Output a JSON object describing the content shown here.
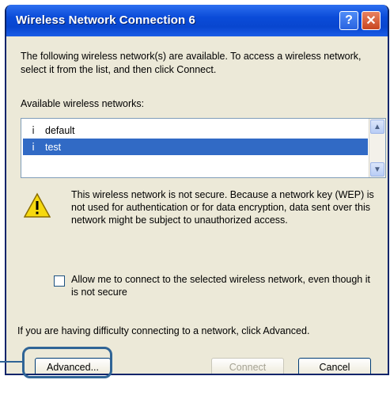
{
  "window": {
    "title": "Wireless Network Connection 6",
    "help_glyph": "?",
    "close_glyph": "✕"
  },
  "intro_text": "The following wireless network(s) are available. To access a wireless network, select it from the list, and then click Connect.",
  "networks_label": "Available wireless networks:",
  "networks": [
    {
      "name": "default",
      "selected": false
    },
    {
      "name": "test",
      "selected": true
    }
  ],
  "warning_text": "This wireless network is not secure. Because a network key (WEP) is not used for authentication or for data encryption, data sent over this network might be subject to unauthorized access.",
  "allow_checkbox": {
    "checked": false,
    "label": "Allow me to connect to the selected wireless network, even though it is not secure"
  },
  "help_text": "If you are having difficulty connecting to a network, click Advanced.",
  "buttons": {
    "advanced": "Advanced...",
    "connect": "Connect",
    "cancel": "Cancel"
  },
  "colors": {
    "titlebar": "#0a4bd8",
    "selection": "#316ac5",
    "highlight_callout": "#2f6496"
  }
}
